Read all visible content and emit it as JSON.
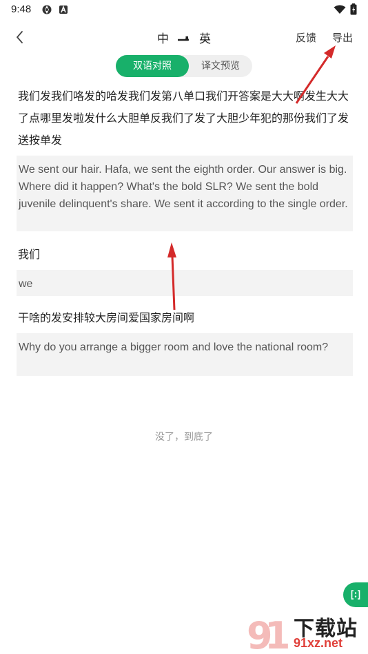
{
  "status_bar": {
    "time": "9:48",
    "icons": [
      "settings-gear-icon",
      "app-a-icon",
      "wifi-icon",
      "battery-icon"
    ]
  },
  "header": {
    "source_lang": "中",
    "target_lang": "英",
    "swap_icon": "arrow-swap-icon",
    "feedback_label": "反馈",
    "export_label": "导出"
  },
  "tabs": {
    "bilingual_label": "双语对照",
    "preview_label": "译文预览",
    "active": "bilingual"
  },
  "segments": [
    {
      "zh": "我们发我们咯发的哈发我们发第八单口我们开答案是大大啊发生大大了点哪里发啦发什么大胆单反我们了发了大胆少年犯的那份我们了发送按单发",
      "en": "We sent our hair. Hafa, we sent the eighth order. Our answer is big. Where did it happen? What's the bold SLR? We sent the bold juvenile delinquent's share. We sent it according to the single order."
    },
    {
      "zh": "我们",
      "en": "we"
    },
    {
      "zh": "干啥的发安排较大房间爱国家房间啊",
      "en": "Why do you arrange a bigger room and love the national room?"
    }
  ],
  "footer": {
    "end_text": "没了，到底了"
  },
  "watermark": {
    "brand": "下载站",
    "domain": "91xz.net"
  },
  "colors": {
    "accent": "#18b06a",
    "annotation_arrow": "#d42a2a",
    "watermark_red": "#e0403a"
  }
}
